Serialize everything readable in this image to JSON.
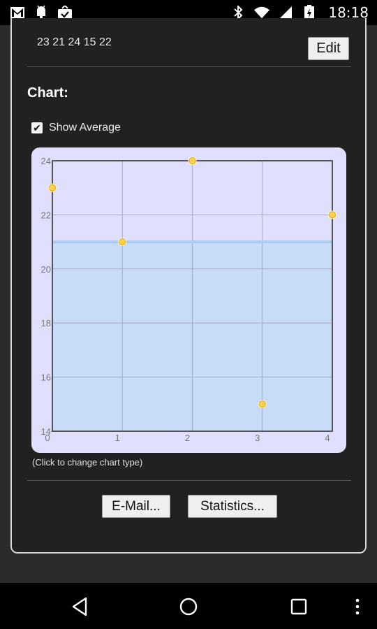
{
  "status_bar": {
    "time": "18:18",
    "icons": [
      "gmail-icon",
      "android-debug-icon",
      "download-done-icon",
      "bluetooth-icon",
      "wifi-icon",
      "signal-icon",
      "battery-icon"
    ]
  },
  "data_section": {
    "numbers": "23 21 24 15 22",
    "edit_label": "Edit"
  },
  "chart_section": {
    "heading": "Chart:",
    "show_average_label": "Show Average",
    "show_average_checked": true,
    "hint": "(Click to change chart type)"
  },
  "chart_data": {
    "type": "scatter",
    "x": [
      0,
      1,
      2,
      3,
      4
    ],
    "y": [
      23,
      21,
      24,
      15,
      22
    ],
    "average": 21,
    "xlim": [
      0,
      4
    ],
    "ylim": [
      14,
      24
    ],
    "x_ticks": [
      "0",
      "1",
      "2",
      "3",
      "4"
    ],
    "y_ticks": [
      "14",
      "16",
      "18",
      "20",
      "22",
      "24"
    ],
    "grid": true,
    "colors": {
      "point": "#ffd24d",
      "average_fill": "#c9dcf7",
      "average_line": "#a9ccee",
      "background": "#e0dffd"
    }
  },
  "actions": {
    "email_label": "E-Mail...",
    "statistics_label": "Statistics..."
  },
  "nav_bar": {
    "icons": [
      "back-icon",
      "home-icon",
      "recents-icon",
      "overflow-menu-icon"
    ]
  }
}
